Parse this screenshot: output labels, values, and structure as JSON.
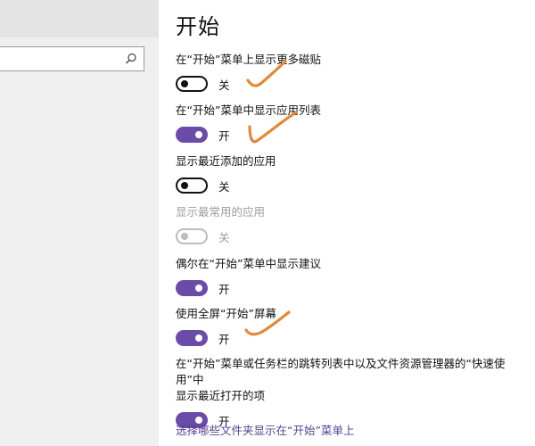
{
  "search": {
    "value": "",
    "placeholder": ""
  },
  "page": {
    "title": "开始"
  },
  "settings": [
    {
      "label": "在“开始”菜单上显示更多磁贴",
      "state": "off",
      "state_label": "关"
    },
    {
      "label": "在“开始”菜单中显示应用列表",
      "state": "on",
      "state_label": "开"
    },
    {
      "label": "显示最近添加的应用",
      "state": "off",
      "state_label": "关"
    },
    {
      "label": "显示最常用的应用",
      "state": "disabled",
      "state_label": "关"
    },
    {
      "label": "偶尔在“开始”菜单中显示建议",
      "state": "on",
      "state_label": "开"
    },
    {
      "label": "使用全屏“开始”屏幕",
      "state": "on",
      "state_label": "开"
    },
    {
      "label_line1": "在“开始”菜单或任务栏的跳转列表中以及文件资源管理器的“快速使用”中",
      "label_line2": "显示最近打开的项",
      "state": "on",
      "state_label": "开"
    }
  ],
  "link": {
    "label": "选择哪些文件夹显示在“开始”菜单上"
  },
  "colors": {
    "accent": "#6b4ba8",
    "link": "#5a3f91",
    "annotation": "#e0893a",
    "sidebar_bg": "#efefef"
  },
  "icons": {
    "search": "search-icon",
    "annotation": "orange-checkmark-annotation"
  }
}
